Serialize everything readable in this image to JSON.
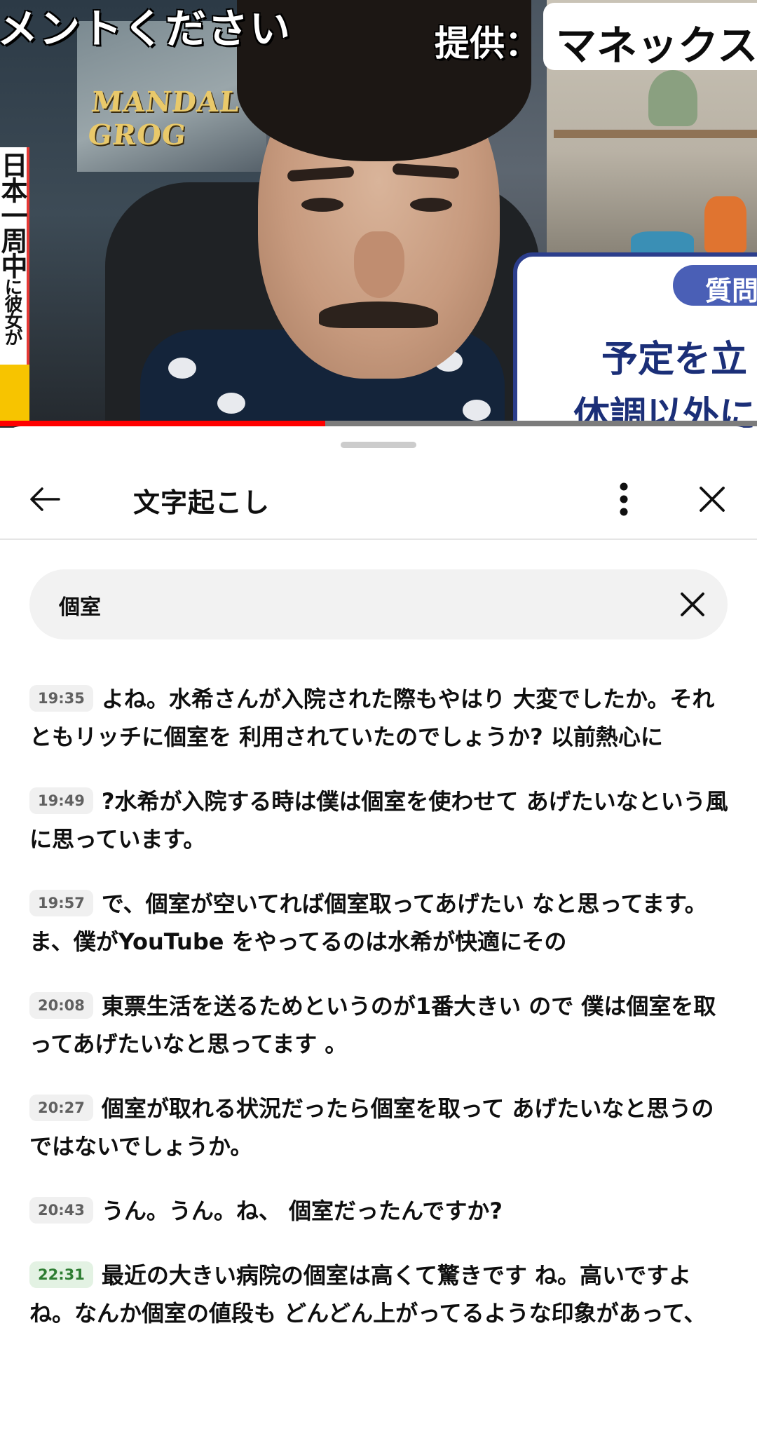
{
  "video": {
    "top_caption": "メントください",
    "sponsor_label": "提供：",
    "sponsor_name": "マネックスの",
    "poster_text": "MANDALOR GROG",
    "banner_main": "日本一周中",
    "banner_sub": "に彼女が",
    "question_tag": "質問",
    "question_line1": "予定を立",
    "question_line2": "体調以外に",
    "progress_fraction": 0.43
  },
  "panel": {
    "title": "文字起こし",
    "back_icon": "arrow-left-icon",
    "menu_icon": "more-vertical-icon",
    "close_icon": "close-icon"
  },
  "search": {
    "value": "個室",
    "clear_icon": "close-icon"
  },
  "segments": [
    {
      "time": "19:35",
      "text": "よね。水希さんが入院された際もやはり 大変でしたか。それともリッチに個室を 利用されていたのでしょうか? 以前熱心に",
      "active": false
    },
    {
      "time": "19:49",
      "text": "?水希が入院する時は僕は個室を使わせて あげたいなという風に思っています。",
      "active": false
    },
    {
      "time": "19:57",
      "text": "で、個室が空いてれば個室取ってあげたい なと思ってます。ま、僕がYouTube をやってるのは水希が快適にその",
      "active": false
    },
    {
      "time": "20:08",
      "text": "東票生活を送るためというのが1番大きい ので 僕は個室を取ってあげたいなと思ってます 。",
      "active": false
    },
    {
      "time": "20:27",
      "text": "個室が取れる状況だったら個室を取って あげたいなと思うのではないでしょうか。",
      "active": false
    },
    {
      "time": "20:43",
      "text": "うん。うん。ね、 個室だったんですか?",
      "active": false
    },
    {
      "time": "22:31",
      "text": "最近の大きい病院の個室は高くて驚きです ね。高いですよね。なんか個室の値段も どんどん上がってるような印象があって、",
      "active": true
    }
  ],
  "colors": {
    "progress": "#ff0000",
    "active_timestamp": "#2e7d32",
    "timestamp_bg": "#f0f0f0",
    "search_bg": "#f2f2f2"
  }
}
